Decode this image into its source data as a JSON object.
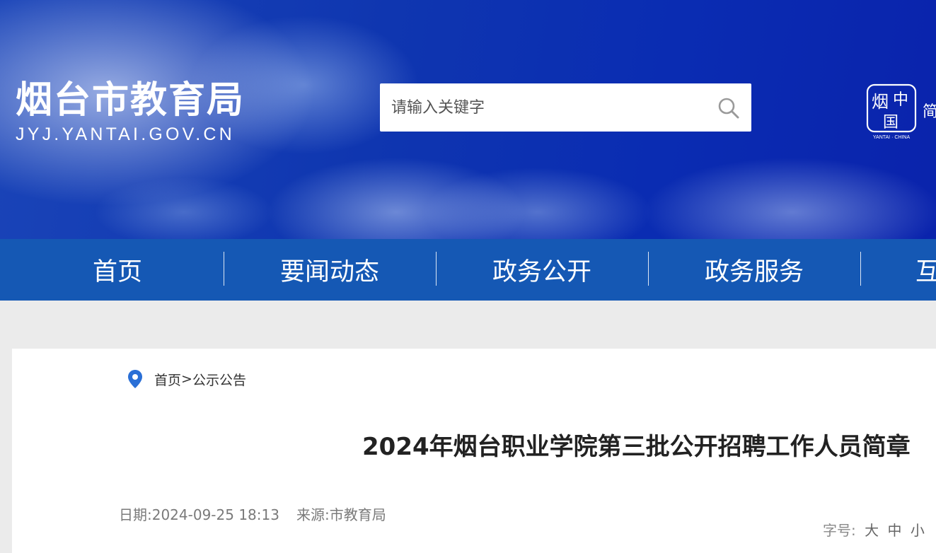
{
  "header": {
    "site_name": "烟台市教育局",
    "site_domain": "JYJ.YANTAI.GOV.CN",
    "search": {
      "placeholder": "请输入关键字"
    },
    "emblem": {
      "caption": "YANTAI · CHINA",
      "glyph_left": "烟",
      "glyph_right": "中",
      "glyph_bottom": "国"
    },
    "lang_toggle": "简"
  },
  "nav": {
    "items": [
      {
        "label": "首页"
      },
      {
        "label": "要闻动态"
      },
      {
        "label": "政务公开"
      },
      {
        "label": "政务服务"
      },
      {
        "label": "互"
      }
    ]
  },
  "breadcrumb": {
    "home": "首页",
    "separator": ">",
    "current": "公示公告"
  },
  "article": {
    "title": "2024年烟台职业学院第三批公开招聘工作人员简章",
    "date": "日期:2024-09-25 18:13",
    "source": "来源:市教育局",
    "font_size": {
      "label": "字号:",
      "large": "大",
      "medium": "中",
      "small": "小"
    }
  },
  "colors": {
    "banner_blue": "#0f36b0",
    "nav_blue": "#1558b4",
    "page_bg": "#ebebeb",
    "pin_blue": "#2a6fd6"
  },
  "icons": {
    "search": "search-icon",
    "location": "location-pin-icon",
    "emblem": "yantai-china-emblem-icon"
  }
}
